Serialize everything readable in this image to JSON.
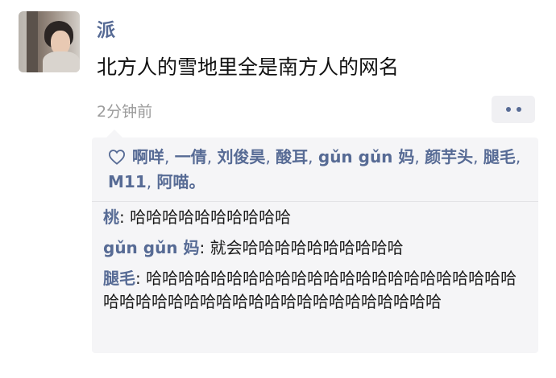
{
  "post": {
    "username": "派",
    "text": "北方人的雪地里全是南方人的网名",
    "timestamp": "2分钟前"
  },
  "icons": {
    "avatar": "profile-photo",
    "heart": "heart-outline-icon",
    "more": "two-dots-icon"
  },
  "colors": {
    "link": "#576b95",
    "feedback_bg": "#f5f5f7",
    "timestamp": "#9b9b9b"
  },
  "likes": [
    "啊咩",
    "一倩",
    "刘俊昊",
    "酸耳",
    "gǔn gǔn 妈",
    "颜芋头",
    "腿毛",
    "M11",
    "阿喵"
  ],
  "likes_terminal": "。",
  "comments": [
    {
      "author": "桃",
      "text": "哈哈哈哈哈哈哈哈哈哈"
    },
    {
      "author": "gǔn gǔn 妈",
      "text": "就会哈哈哈哈哈哈哈哈哈哈"
    },
    {
      "author": "腿毛",
      "text": "哈哈哈哈哈哈哈哈哈哈哈哈哈哈哈哈哈哈哈哈哈哈哈哈哈哈哈哈哈哈哈哈哈哈哈哈哈哈哈哈哈哈哈哈"
    }
  ]
}
